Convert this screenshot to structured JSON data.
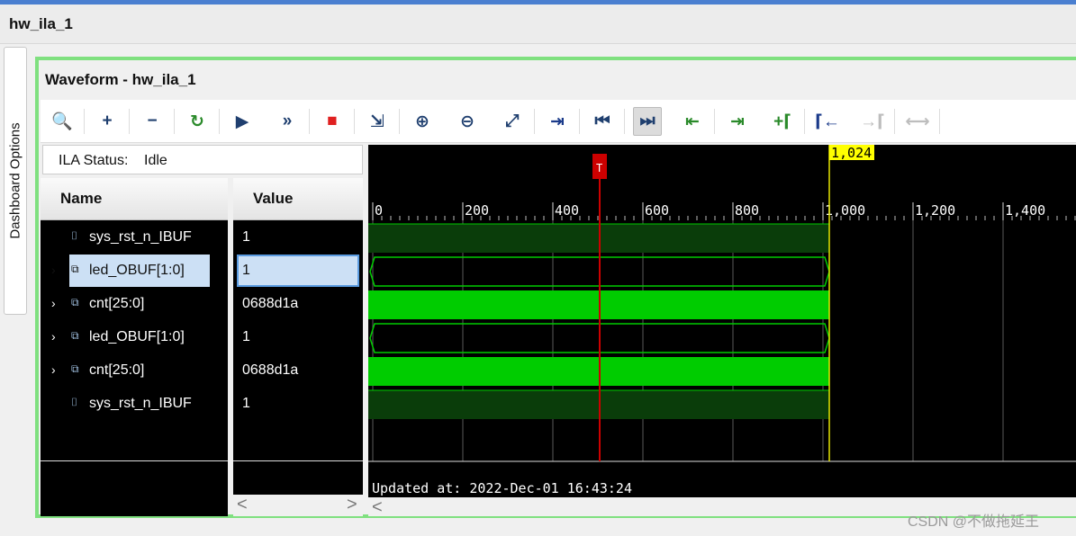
{
  "window": {
    "title": "hw_ila_1"
  },
  "side_tab": {
    "label": "Dashboard Options"
  },
  "panel": {
    "title": "Waveform - hw_ila_1"
  },
  "status": {
    "label": "ILA Status:",
    "value": "Idle"
  },
  "columns": {
    "name": "Name",
    "value": "Value"
  },
  "signals": [
    {
      "name": "sys_rst_n_IBUF",
      "value": "1",
      "expandable": false,
      "icon": "bit-signal-icon",
      "selected": false
    },
    {
      "name": "led_OBUF[1:0]",
      "value": "1",
      "expandable": true,
      "icon": "bus-signal-icon",
      "selected": true
    },
    {
      "name": "cnt[25:0]",
      "value": "0688d1a",
      "expandable": true,
      "icon": "bus-signal-icon",
      "selected": false
    },
    {
      "name": "led_OBUF[1:0]",
      "value": "1",
      "expandable": true,
      "icon": "bus-signal-icon",
      "selected": false
    },
    {
      "name": "cnt[25:0]",
      "value": "0688d1a",
      "expandable": true,
      "icon": "bus-signal-icon",
      "selected": false
    },
    {
      "name": "sys_rst_n_IBUF",
      "value": "1",
      "expandable": false,
      "icon": "bit-signal-icon",
      "selected": false
    }
  ],
  "waveform": {
    "ticks": [
      "0",
      "200",
      "400",
      "600",
      "800",
      "1,000",
      "1,200",
      "1,400"
    ],
    "cursor_label": "1,024",
    "trigger_marker": "T",
    "updated_text": "Updated at: 2022-Dec-01 16:43:24"
  },
  "toolbar": [
    {
      "name": "search-icon",
      "glyph": "🔍",
      "disabled": false
    },
    {
      "name": "add-icon",
      "glyph": "+",
      "disabled": false
    },
    {
      "name": "remove-icon",
      "glyph": "−",
      "disabled": false
    },
    {
      "name": "run-trigger-immediate-icon",
      "glyph": "↻",
      "disabled": false
    },
    {
      "name": "run-trigger-icon",
      "glyph": "▶",
      "disabled": false
    },
    {
      "name": "run-immediate-icon",
      "glyph": "»",
      "disabled": false
    },
    {
      "name": "stop-icon",
      "glyph": "■",
      "disabled": false
    },
    {
      "name": "export-icon",
      "glyph": "⇲",
      "disabled": false
    },
    {
      "name": "zoom-in-icon",
      "glyph": "⊕",
      "disabled": false
    },
    {
      "name": "zoom-out-icon",
      "glyph": "⊖",
      "disabled": false
    },
    {
      "name": "zoom-fit-icon",
      "glyph": "⤢",
      "disabled": false
    },
    {
      "name": "go-to-cursor-icon",
      "glyph": "⇥",
      "disabled": false
    },
    {
      "name": "go-to-time-zero-icon",
      "glyph": "⏮",
      "disabled": false
    },
    {
      "name": "go-to-last-time-icon",
      "glyph": "⏭",
      "disabled": false
    },
    {
      "name": "previous-transition-icon",
      "glyph": "⇤",
      "disabled": false
    },
    {
      "name": "next-transition-icon",
      "glyph": "⇥",
      "disabled": false
    },
    {
      "name": "add-marker-icon",
      "glyph": "+⌈",
      "disabled": false
    },
    {
      "name": "previous-marker-icon",
      "glyph": "⌈←",
      "disabled": false
    },
    {
      "name": "next-marker-icon",
      "glyph": "→⌈",
      "disabled": true
    },
    {
      "name": "swap-cursors-icon",
      "glyph": "⟷",
      "disabled": true
    }
  ],
  "colors": {
    "panel_border": "#7fe07f",
    "waveform_bg": "#000000",
    "bus_green": "#00cc00",
    "dark_green": "#0a3d0a",
    "trigger_red": "#cc0000",
    "cursor_yellow": "#e6e600"
  },
  "watermark": "CSDN @不做拖延王"
}
